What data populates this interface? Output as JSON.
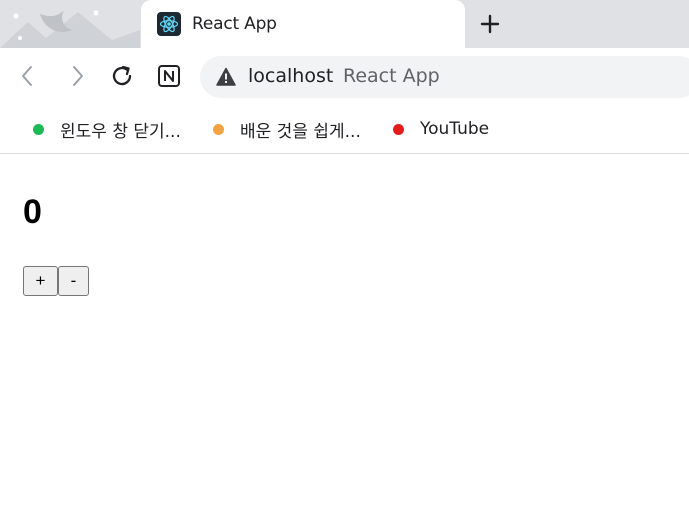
{
  "browser": {
    "tab": {
      "title": "React App",
      "favicon": "react-logo-icon"
    },
    "new_tab_icon": "plus-icon",
    "toolbar": {
      "back_icon": "chevron-left-icon",
      "forward_icon": "chevron-right-icon",
      "reload_icon": "reload-icon",
      "extension_icon": "notion-icon",
      "security_icon": "warning-triangle-icon"
    },
    "address_bar": {
      "host": "localhost",
      "page_title": "React App"
    },
    "bookmarks": [
      {
        "label": "윈도우 창 닫기...",
        "color": "#1db954"
      },
      {
        "label": "배운 것을 쉽게...",
        "color": "#f2a445"
      },
      {
        "label": "YouTube",
        "color": "#e31b1b"
      }
    ]
  },
  "page": {
    "counter_value": "0",
    "increment_label": "+",
    "decrement_label": "-"
  }
}
